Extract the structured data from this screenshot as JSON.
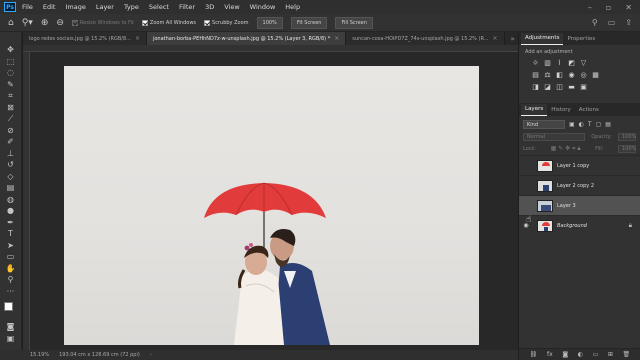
{
  "menubar": {
    "logo": "Ps",
    "items": [
      "File",
      "Edit",
      "Image",
      "Layer",
      "Type",
      "Select",
      "Filter",
      "3D",
      "View",
      "Window",
      "Help"
    ]
  },
  "options": {
    "resize_windows": "Resize Windows to Fit",
    "zoom_all": "Zoom All Windows",
    "scrubby_zoom": "Scrubby Zoom",
    "btn_100": "100%",
    "btn_fit": "Fit Screen",
    "btn_fill": "Fill Screen"
  },
  "tabs": [
    {
      "label": "logo redes sociais.jpg @ 15.2% (RGB/8...",
      "active": false
    },
    {
      "label": "jonathan-borba-PEHhND7z-w-unsplash.jpg @ 15.2% (Layer 3, RGB/8) *",
      "active": true
    },
    {
      "label": "suncan-cosa-HOIPD7Z_74s-unsplash.jpg @ 15.2% (R...",
      "active": false
    }
  ],
  "status": {
    "zoom": "15.19%",
    "doc_size": "193.04 cm x 128.69 cm (72 ppi)"
  },
  "panels": {
    "adjustments_tab": "Adjustments",
    "properties_tab": "Properties",
    "add_adjustment": "Add an adjustment",
    "layers_tab": "Layers",
    "history_tab": "History",
    "actions_tab": "Actions",
    "kind": "Kind",
    "blend_mode": "Normal",
    "opacity_label": "Opacity:",
    "opacity_value": "100%",
    "lock_label": "Lock:",
    "fill_label": "Fill:",
    "fill_value": "100%"
  },
  "layers": [
    {
      "name": "Layer 1 copy",
      "visible": false,
      "selected": false
    },
    {
      "name": "Layer 2 copy 2",
      "visible": false,
      "selected": false
    },
    {
      "name": "Layer 3",
      "visible": false,
      "selected": true
    },
    {
      "name": "Background",
      "visible": true,
      "selected": false,
      "locked": true
    }
  ],
  "colors": {
    "accent": "#31a8ff",
    "umbrella": "#e23b3b",
    "photo_bg": "#e6e4e1"
  }
}
